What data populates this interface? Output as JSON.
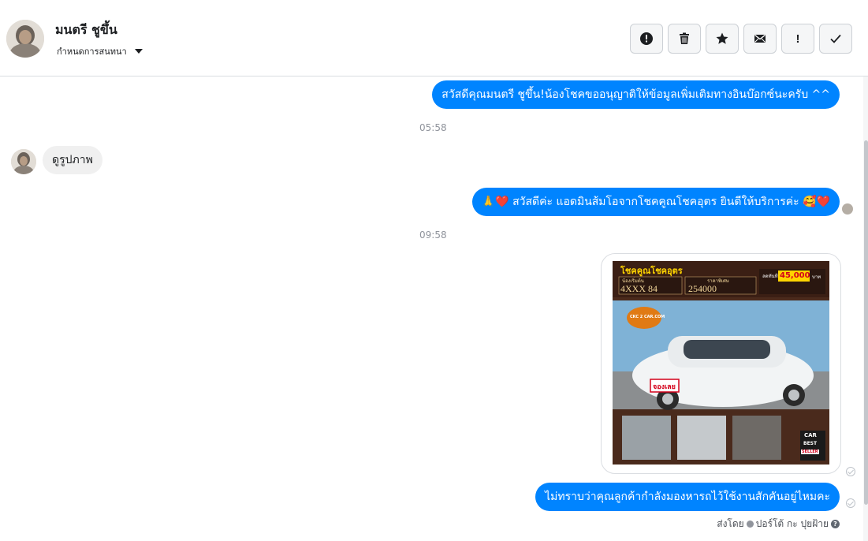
{
  "header": {
    "contact_name": "มนตรี ชูขึ้น",
    "assign_label": "กำหนดการสนทนา",
    "actions": [
      {
        "icon": "alert-circle-icon",
        "label": "!"
      },
      {
        "icon": "trash-icon",
        "label": ""
      },
      {
        "icon": "star-icon",
        "label": ""
      },
      {
        "icon": "envelope-icon",
        "label": ""
      },
      {
        "icon": "exclamation-icon",
        "label": "!"
      },
      {
        "icon": "checkmark-icon",
        "label": ""
      }
    ]
  },
  "messages": [
    {
      "direction": "out",
      "text": "สวัสดีคุณมนตรี ชูขึ้น!น้องโชคขออนุญาติให้ข้อมูลเพิ่มเติมทางอินบ๊อกซ์นะครับ ^^"
    },
    {
      "time": "05:58"
    },
    {
      "direction": "in",
      "text": "ดูรูปภาพ"
    },
    {
      "direction": "out",
      "text": "🙏❤️ สวัสดีค่ะ แอดมินส้มโอจากโชคคูณโชคอุตร ยินดีให้บริการค่ะ 🥰❤️"
    },
    {
      "time": "09:58"
    },
    {
      "direction": "out",
      "type": "image",
      "ad": {
        "brand": "โชคคูณโชคอุตร",
        "plate_label": "น้องเริ่มต้น",
        "plate": "4XXX 84",
        "price_label": "ราคาพิเศษ",
        "price": "254000",
        "discount_label": "ลดทันที",
        "discount": "45,000",
        "discount_unit": "บาท",
        "logo_text": "CKC 2 CAR.COM",
        "stamp": "จองเลย",
        "badge_top": "CAR",
        "badge_mid": "BEST",
        "badge_bottom": "SELLER"
      }
    },
    {
      "direction": "out",
      "text": "ไม่ทราบว่าคุณลูกค้ากำลังมองหารถไว้ใช้งานสักคันอยู่ไหมคะ"
    }
  ],
  "footer": {
    "sent_by_label": "ส่งโดย",
    "sender": "ปอร์โต้ กะ ปุยฝ้าย",
    "help_icon": "question-circle-icon"
  },
  "colors": {
    "bubble_out": "#0084ff",
    "bubble_in": "#f0f0f0",
    "timestamp": "#90949c"
  }
}
